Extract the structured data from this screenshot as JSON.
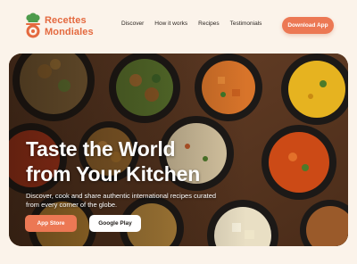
{
  "brand": {
    "line1": "Recettes",
    "line2": "Mondiales"
  },
  "nav": {
    "links": [
      "Discover",
      "How it works",
      "Recipes",
      "Testimonials"
    ],
    "download_label": "Download App"
  },
  "hero": {
    "headline": "Taste the World\nfrom Your Kitchen",
    "subtext": "Discover, cook and share authentic international recipes curated from every corner of the globe.",
    "app_store_label": "App Store",
    "google_play_label": "Google Play"
  },
  "colors": {
    "accent": "#ec7854",
    "background": "#fbf3ea",
    "logo": "#e4693f"
  },
  "icons": {
    "logo": "chef-hat-pot-icon"
  }
}
